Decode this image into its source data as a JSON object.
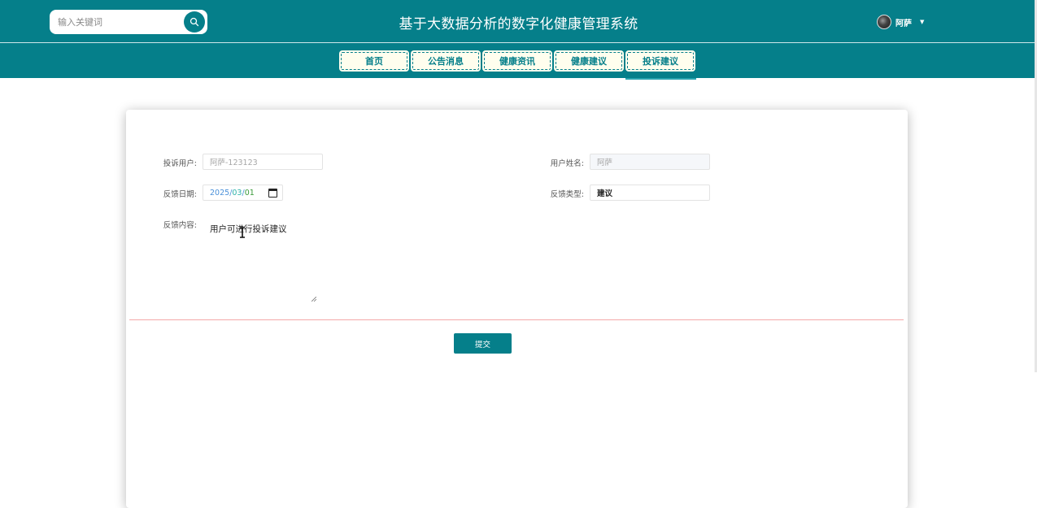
{
  "header": {
    "title": "基于大数据分析的数字化健康管理系统",
    "search_placeholder": "输入关键词",
    "user_name": "阿萨",
    "accent_color": "#057f8a"
  },
  "nav": {
    "items": [
      "首页",
      "公告消息",
      "健康资讯",
      "健康建议",
      "投诉建议"
    ],
    "active": "投诉建议"
  },
  "form": {
    "complaint_user_label": "投诉用户:",
    "complaint_user_value": "阿萨-123123",
    "user_name_label": "用户姓名:",
    "user_name_value": "阿萨",
    "feedback_date_label": "反馈日期:",
    "date_year": "2025",
    "date_month": "03",
    "date_day": "01",
    "feedback_type_label": "反馈类型:",
    "feedback_type_value": "建议",
    "feedback_content_label": "反馈内容:",
    "feedback_content_value": "用户可进行投诉建议",
    "submit_label": "提交"
  }
}
